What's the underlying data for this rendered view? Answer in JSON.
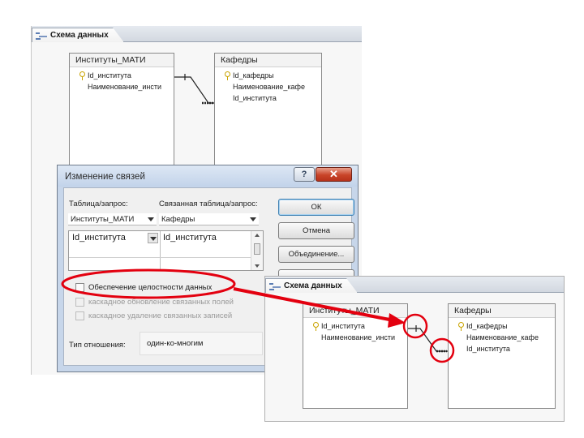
{
  "back_schema": {
    "tab_label": "Схема данных",
    "tables": [
      {
        "title": "Институты_МАТИ",
        "fields": [
          {
            "name": "Id_института",
            "key": true
          },
          {
            "name": "Наименование_инсти",
            "key": false
          }
        ]
      },
      {
        "title": "Кафедры",
        "fields": [
          {
            "name": "Id_кафедры",
            "key": true
          },
          {
            "name": "Наименование_кафе",
            "key": false
          },
          {
            "name": "Id_института",
            "key": false
          }
        ]
      }
    ]
  },
  "dialog": {
    "title": "Изменение связей",
    "help_symbol": "?",
    "close_symbol": "✕",
    "table_query_label": "Таблица/запрос:",
    "related_table_label": "Связанная таблица/запрос:",
    "table_query_value": "Институты_МАТИ",
    "related_table_value": "Кафедры",
    "left_field": "Id_института",
    "right_field": "Id_института",
    "ok_button": "ОК",
    "cancel_button": "Отмена",
    "join_button": "Объединение...",
    "checkbox_integrity": "Обеспечение целостности данных",
    "checkbox_cascade_update": "каскадное обновление связанных полей",
    "checkbox_cascade_delete": "каскадное удаление связанных записей",
    "relation_type_label": "Тип отношения:",
    "relation_type_value": "один-ко-многим"
  },
  "front_schema": {
    "tab_label": "Схема данных",
    "tables": [
      {
        "title": "Институты_МАТИ",
        "fields": [
          {
            "name": "Id_института",
            "key": true
          },
          {
            "name": "Наименование_инсти",
            "key": false
          }
        ]
      },
      {
        "title": "Кафедры",
        "fields": [
          {
            "name": "Id_кафедры",
            "key": true
          },
          {
            "name": "Наименование_кафе",
            "key": false
          },
          {
            "name": "Id_института",
            "key": false
          }
        ]
      }
    ]
  },
  "colors": {
    "annotation_red": "#e3000f",
    "close_button": "#c94428",
    "dialog_frame": "#c7d6ea"
  },
  "icons": [
    "schema-tab-icon",
    "key-icon",
    "help-icon",
    "close-icon",
    "dropdown-arrow-icon",
    "checkbox-icon"
  ]
}
